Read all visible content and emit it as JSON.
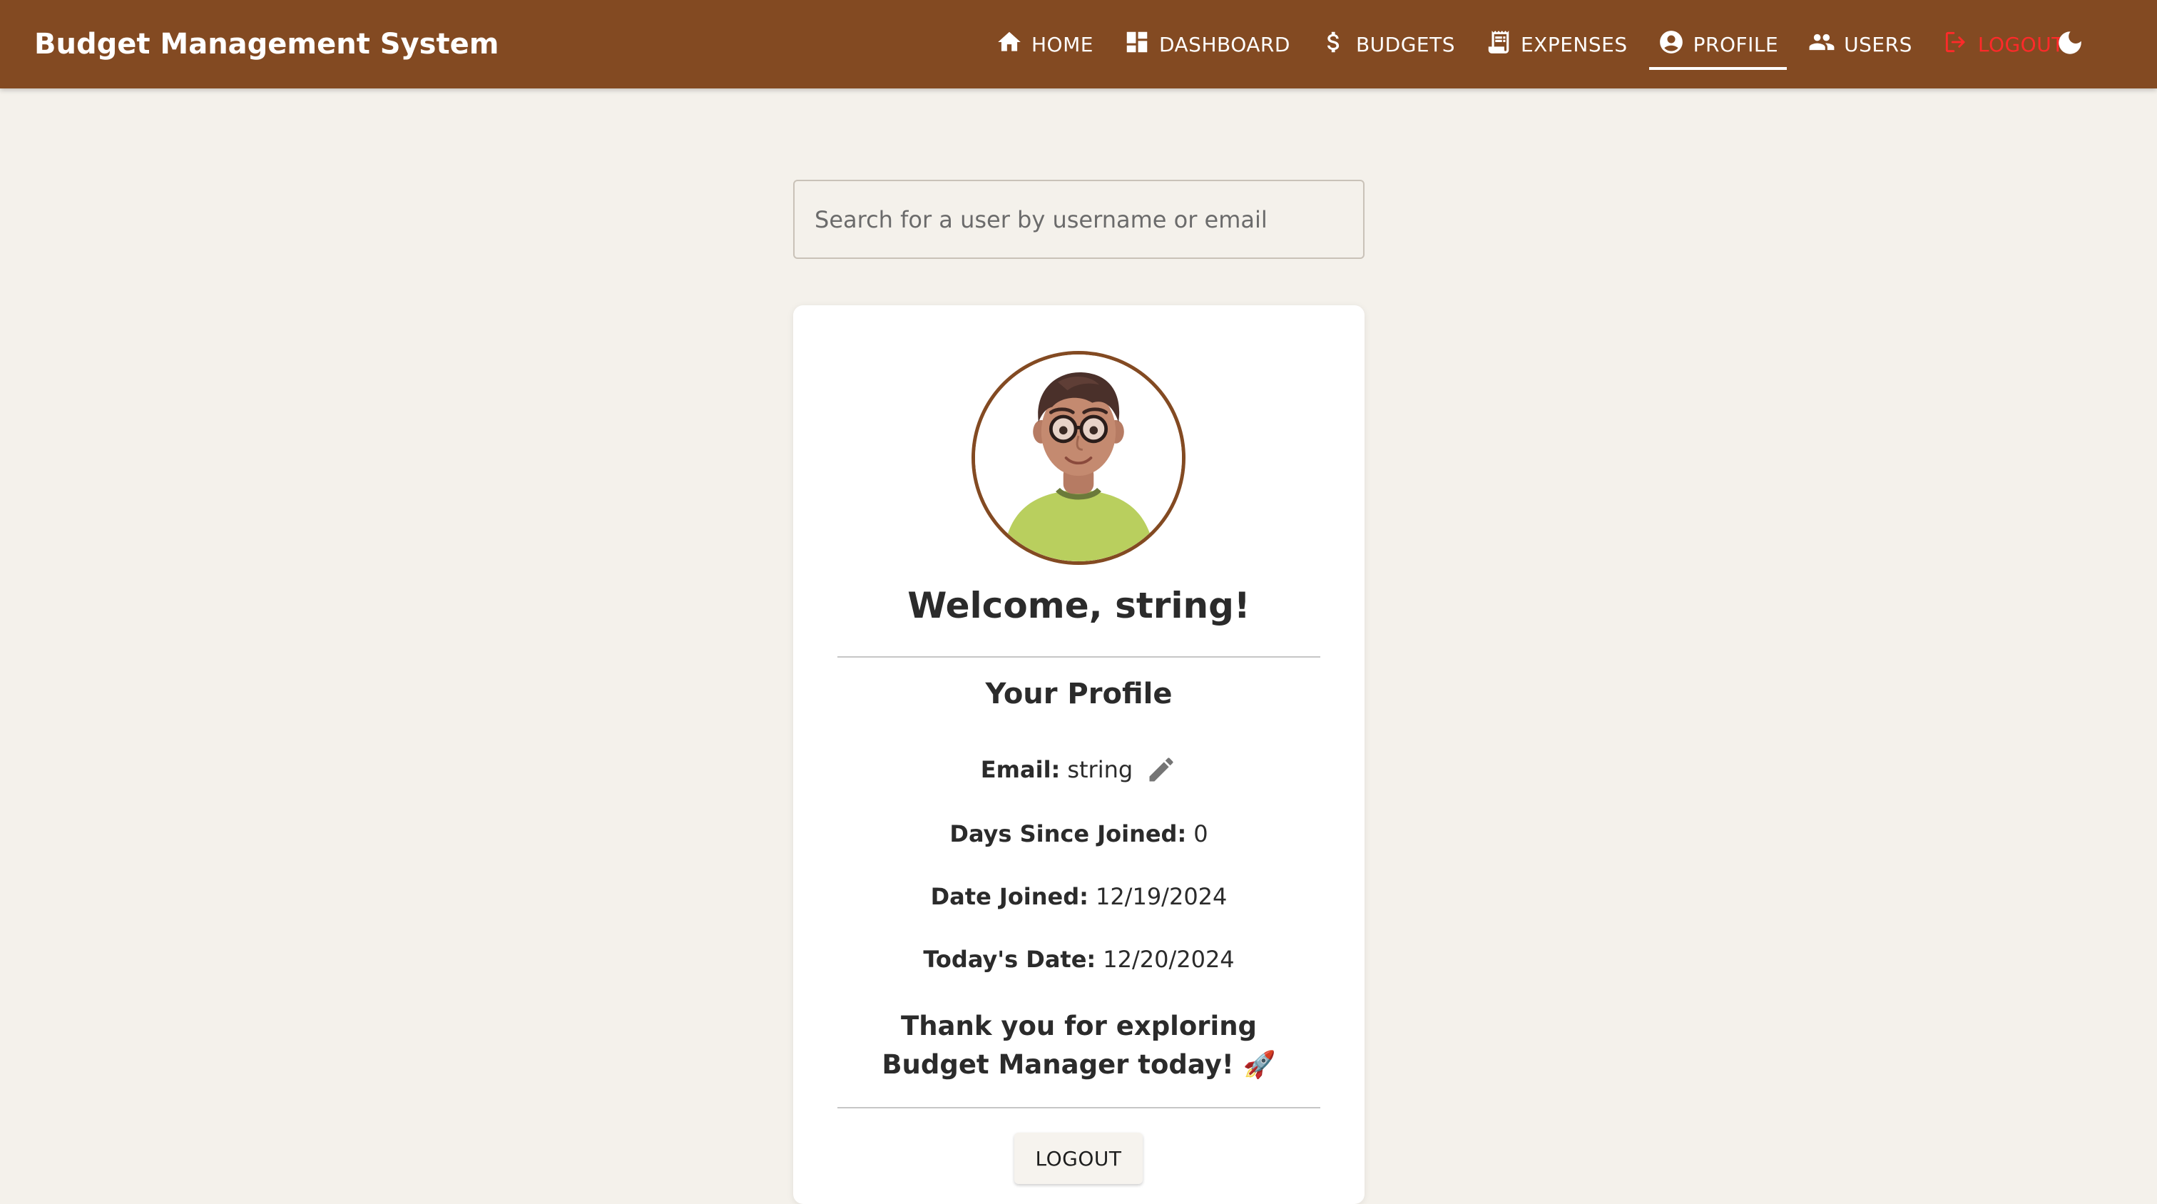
{
  "app": {
    "title": "Budget Management System"
  },
  "nav": {
    "items": [
      {
        "label": "HOME",
        "icon": "home-icon"
      },
      {
        "label": "DASHBOARD",
        "icon": "dashboard-icon"
      },
      {
        "label": "BUDGETS",
        "icon": "dollar-icon"
      },
      {
        "label": "EXPENSES",
        "icon": "receipt-icon"
      },
      {
        "label": "PROFILE",
        "icon": "account-circle-icon",
        "active": true
      },
      {
        "label": "USERS",
        "icon": "people-icon"
      },
      {
        "label": "LOGOUT",
        "icon": "logout-icon"
      }
    ],
    "theme_toggle_icon": "moon-icon"
  },
  "search": {
    "placeholder": "Search for a user by username or email",
    "value": ""
  },
  "profile": {
    "welcome": "Welcome, string!",
    "section_title": "Your Profile",
    "email_label": "Email:",
    "email_value": "string",
    "days_label": "Days Since Joined:",
    "days_value": "0",
    "joined_label": "Date Joined:",
    "joined_value": "12/19/2024",
    "today_label": "Today's Date:",
    "today_value": "12/20/2024",
    "thanks": "Thank you for exploring Budget Manager today! 🚀",
    "logout_button": "LOGOUT",
    "avatar_icon": "user-avatar-illustration"
  },
  "colors": {
    "brand": "#834a22",
    "background": "#f4f1eb",
    "card": "#ffffff",
    "logout_red": "#ff2a2a",
    "text": "#2b2b2b"
  }
}
